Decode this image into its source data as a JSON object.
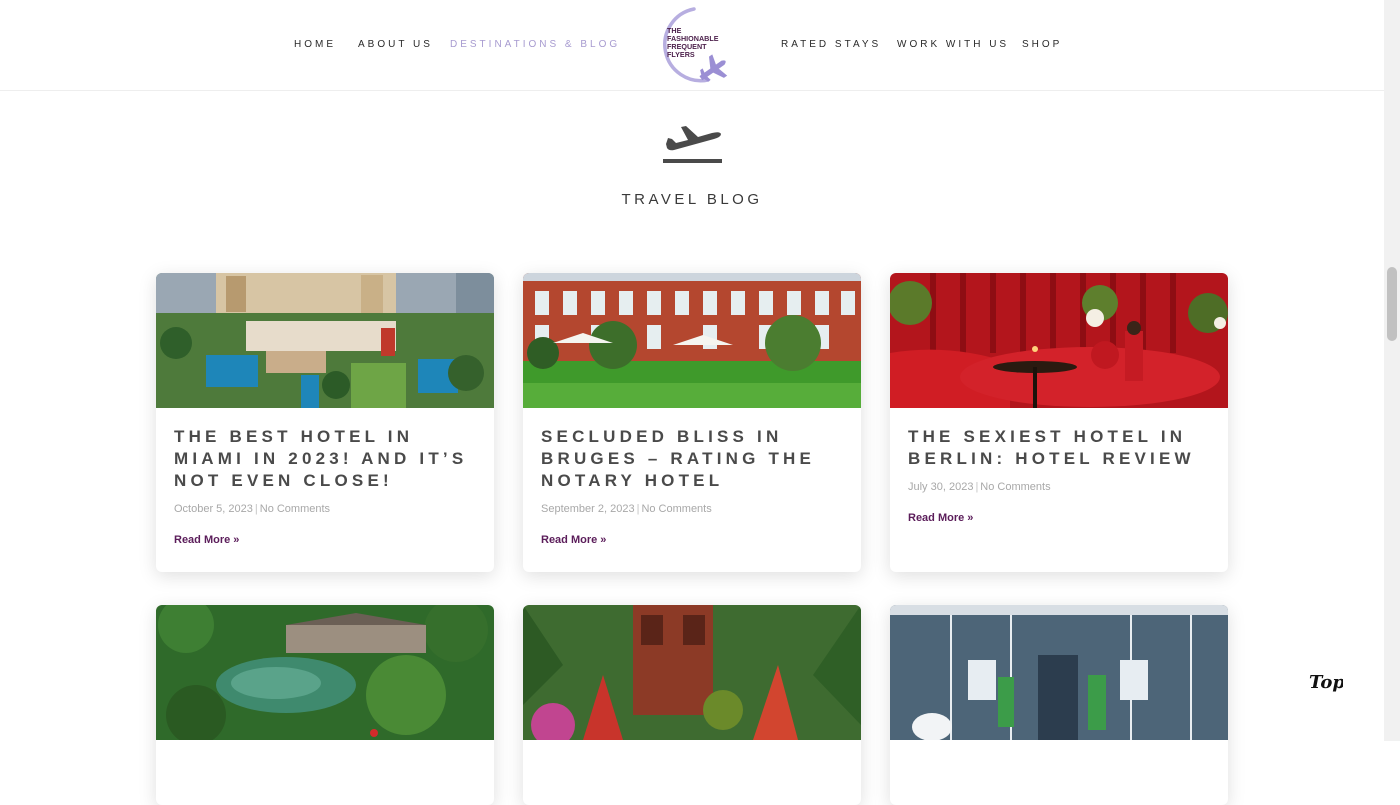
{
  "nav": {
    "home": "HOME",
    "about": "ABOUT US",
    "destinations": "DESTINATIONS & BLOG",
    "rated": "RATED STAYS",
    "work": "WORK WITH US",
    "shop": "SHOP"
  },
  "logo": {
    "line1": "THE",
    "line2": "FASHIONABLE",
    "line3": "FREQUENT",
    "line4": "FLYERS"
  },
  "section": {
    "title": "TRAVEL BLOG"
  },
  "posts": [
    {
      "title": "THE BEST HOTEL IN MIAMI IN 2023! AND IT’S NOT EVEN CLOSE!",
      "date": "October 5, 2023",
      "comments": "No Comments",
      "read_more": "Read More »"
    },
    {
      "title": "SECLUDED BLISS IN BRUGES – RATING THE NOTARY HOTEL",
      "date": "September 2, 2023",
      "comments": "No Comments",
      "read_more": "Read More »"
    },
    {
      "title": "THE SEXIEST HOTEL IN BERLIN: HOTEL REVIEW",
      "date": "July 30, 2023",
      "comments": "No Comments",
      "read_more": "Read More »"
    }
  ],
  "back_to_top": "Top",
  "colors": {
    "accent": "#a79bd0",
    "read_more": "#5b1d5a",
    "logo_purple": "#9b8fd4"
  }
}
